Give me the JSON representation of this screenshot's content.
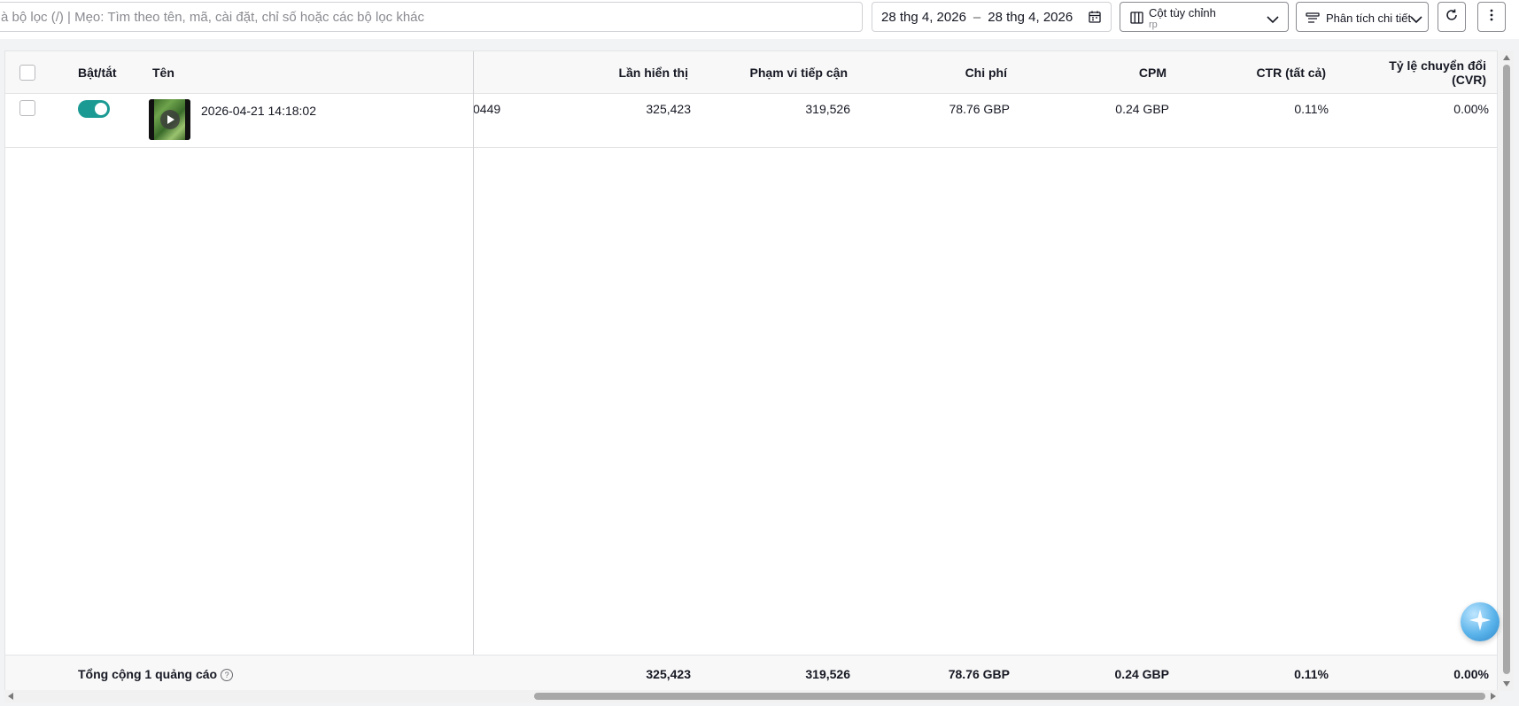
{
  "toolbar": {
    "search_placeholder": "à bộ lọc (/) | Mẹo: Tìm theo tên, mã, cài đặt, chỉ số hoặc các bộ lọc khác",
    "date_start": "28 thg 4, 2026",
    "date_separator": "–",
    "date_end": "28 thg 4, 2026",
    "columns_label": "Cột tùy chỉnh",
    "columns_sub": "rp",
    "breakdown_label": "Phân tích chi tiết"
  },
  "table": {
    "headers": {
      "toggle": "Bật/tắt",
      "name": "Tên",
      "impressions": "Lần hiển thị",
      "reach": "Phạm vi tiếp cận",
      "cost": "Chi phí",
      "cpm": "CPM",
      "ctr": "CTR (tất cả)",
      "cvr_line1": "Tỷ lệ chuyển đổi",
      "cvr_line2": "(CVR)"
    },
    "rows": [
      {
        "enabled": true,
        "name": "2026-04-21 14:18:02",
        "id_fragment": "0449",
        "impressions": "325,423",
        "reach": "319,526",
        "cost": "78.76 GBP",
        "cpm": "0.24 GBP",
        "ctr": "0.11%",
        "cvr": "0.00%"
      }
    ],
    "footer": {
      "label": "Tổng cộng 1 quảng cáo",
      "help": "?",
      "impressions": "325,423",
      "reach": "319,526",
      "cost": "78.76 GBP",
      "cpm": "0.24 GBP",
      "ctr": "0.11%",
      "cvr": "0.00%"
    }
  },
  "colors": {
    "toggle_on": "#1a9a93",
    "header_bg": "#f8f8f8",
    "border": "#e3e4e6"
  }
}
